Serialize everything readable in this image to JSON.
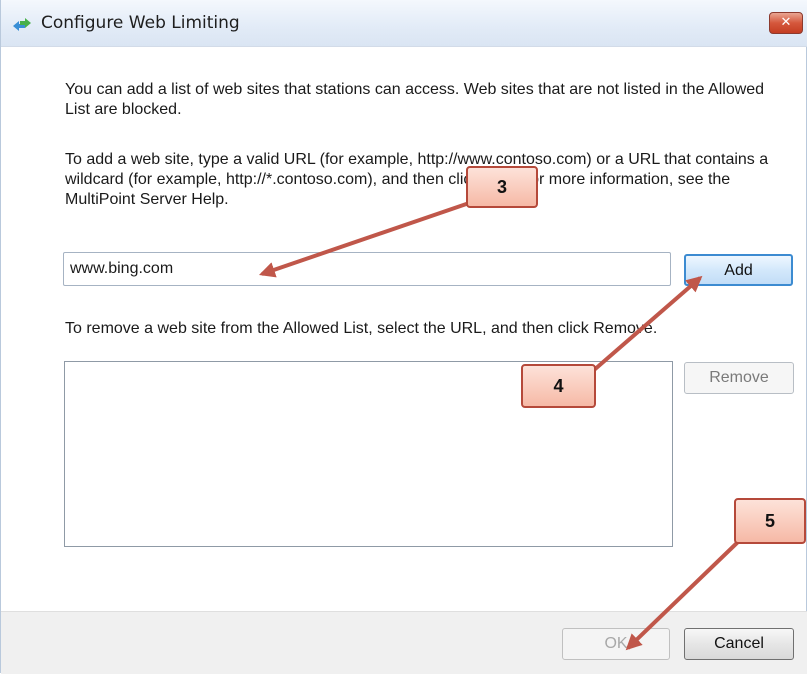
{
  "window": {
    "title": "Configure Web Limiting",
    "close_label": "✕"
  },
  "content": {
    "intro_text": "You can add a list of web sites that stations can access. Web sites that are not listed in the Allowed List are blocked.",
    "add_instructions": "To add a web site, type a valid URL (for example, http://www.contoso.com) or a URL that contains a wildcard (for example, http://*.contoso.com), and then click Add. For more information, see the MultiPoint Server Help.",
    "url_input_value": "www.bing.com",
    "add_button_label": "Add",
    "remove_instructions": "To remove a web site from the Allowed List, select the URL, and then click Remove.",
    "remove_button_label": "Remove",
    "allowed_list": []
  },
  "footer": {
    "ok_label": "OK",
    "cancel_label": "Cancel"
  },
  "callouts": {
    "step3": "3",
    "step4": "4",
    "step5": "5"
  },
  "colors": {
    "callout_fill": "#f6b9a6",
    "callout_border": "#b5493a",
    "arrow": "#c0574a",
    "add_button_focus": "#3c8bd1"
  }
}
